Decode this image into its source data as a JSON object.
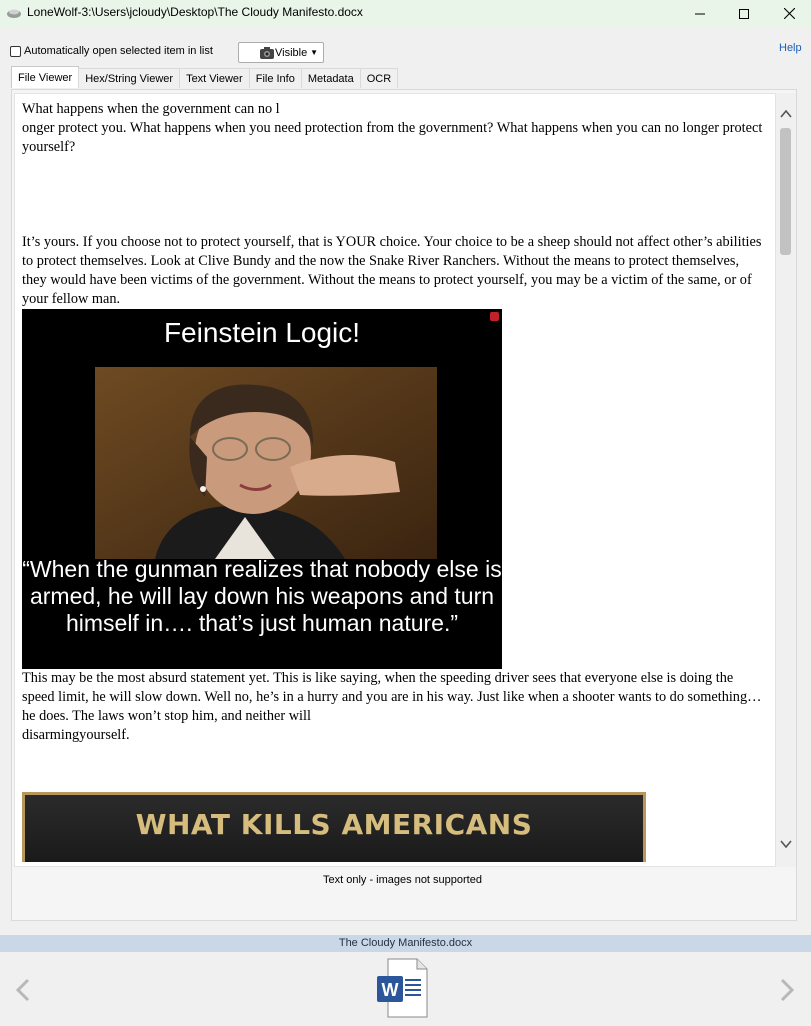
{
  "window": {
    "title": "LoneWolf-3:\\Users\\jcloudy\\Desktop\\The Cloudy Manifesto.docx",
    "app_icon": "lonewolf-app-icon",
    "minimize_icon": "minimize-icon",
    "maximize_icon": "maximize-icon",
    "close_icon": "close-icon"
  },
  "toolbar": {
    "auto_open_label": "Automatically open selected item in list",
    "auto_open_checked": false,
    "visibility_label": "Visible",
    "visibility_icon": "camera-icon",
    "help_label": "Help"
  },
  "tabs": [
    {
      "label": "File Viewer",
      "active": true
    },
    {
      "label": "Hex/String Viewer",
      "active": false
    },
    {
      "label": "Text Viewer",
      "active": false
    },
    {
      "label": "File Info",
      "active": false
    },
    {
      "label": "Metadata",
      "active": false
    },
    {
      "label": "OCR",
      "active": false
    }
  ],
  "document": {
    "para1_line1": "What happens when the government can no l",
    "para1_rest": "onger protect you. What happens when you need protection from the government? What happens when you can no longer protect yourself?",
    "para2": "It’s yours. If you choose not to protect yourself, that is YOUR choice. Your choice to be a sheep should not affect other’s abilities to protect themselves. Look at Clive Bundy and the now the Snake River Ranchers. Without the means to protect themselves, they would have been victims of the government. Without the means to protect yourself, you may be a victim of the same, or of your fellow man.",
    "image1": {
      "heading": "Feinstein Logic!",
      "quote": "“When the gunman realizes that nobody else is armed, he will lay down his weapons and turn himself in…. that’s just human nature.”"
    },
    "para3": "This may be the most absurd statement yet. This is like saying, when the speeding driver sees that everyone else is doing the speed limit, he will slow down. Well no, he’s in a hurry and you are in his way. Just like when a shooter wants to do something…he does. The laws won’t stop him, and neither will",
    "para3_last": "disarmingyourself.",
    "image2": {
      "heading": "WHAT KILLS AMERICANS"
    }
  },
  "viewer_note": "Text only - images not supported",
  "status_filename": "The Cloudy Manifesto.docx",
  "nav": {
    "prev_icon": "chevron-left-icon",
    "next_icon": "chevron-right-icon",
    "file_icon": "word-document-icon"
  }
}
